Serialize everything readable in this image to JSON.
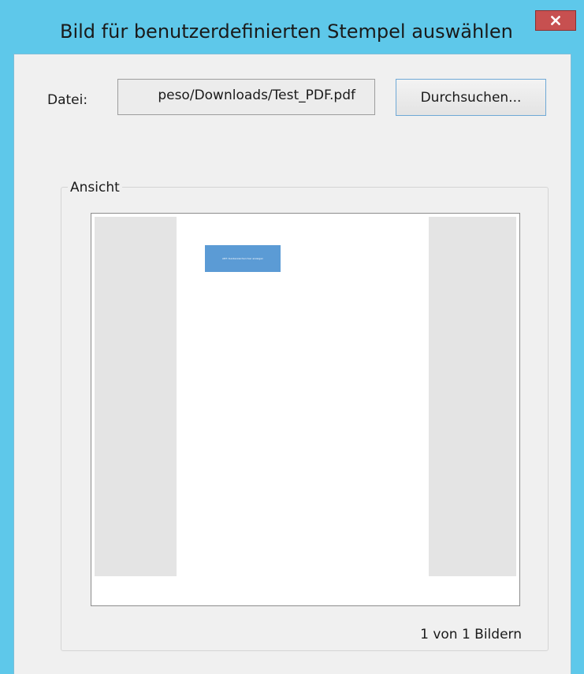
{
  "window": {
    "title": "Bild für benutzerdefinierten Stempel auswählen",
    "close_label": "x"
  },
  "file": {
    "label": "Datei:",
    "value": "peso/Downloads/Test_PDF.pdf",
    "browse_label": "Durchsuchen..."
  },
  "preview": {
    "group_label": "Ansicht",
    "stamp_text": "ANT: Kundenzeichen hier anzeigen",
    "page_count": "1 von 1 Bildern"
  },
  "colors": {
    "titlebar": "#5ec8ea",
    "close_button": "#c75050",
    "stamp": "#5b9bd5"
  },
  "icons": {
    "close": "close-icon"
  }
}
